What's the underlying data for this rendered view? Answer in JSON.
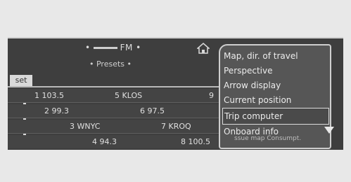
{
  "header": {
    "band": "FM",
    "presets": "• Presets •",
    "set_tab": "set"
  },
  "icons": {
    "home": "home-icon",
    "scroll": "scroll-down-arrow-icon"
  },
  "stations": [
    {
      "label": "1 103.5"
    },
    {
      "label": "5 KLOS"
    },
    {
      "label": "9"
    },
    {
      "label": "2 99.3"
    },
    {
      "label": "6 97.5"
    },
    {
      "label": "3 WNYC"
    },
    {
      "label": "7 KROQ"
    },
    {
      "label": "4 94.3"
    },
    {
      "label": "8 100.5"
    }
  ],
  "menu": {
    "items": [
      {
        "label": "Map, dir. of travel"
      },
      {
        "label": "Perspective"
      },
      {
        "label": "Arrow display"
      },
      {
        "label": "Current position"
      },
      {
        "label": "Trip computer"
      },
      {
        "label": "Onboard info"
      }
    ],
    "footer": "ssue map  Consumpt."
  },
  "colors": {
    "screen_bg": "#3e3e3e",
    "menu_bg": "#565656",
    "text": "#e0e0e0"
  }
}
